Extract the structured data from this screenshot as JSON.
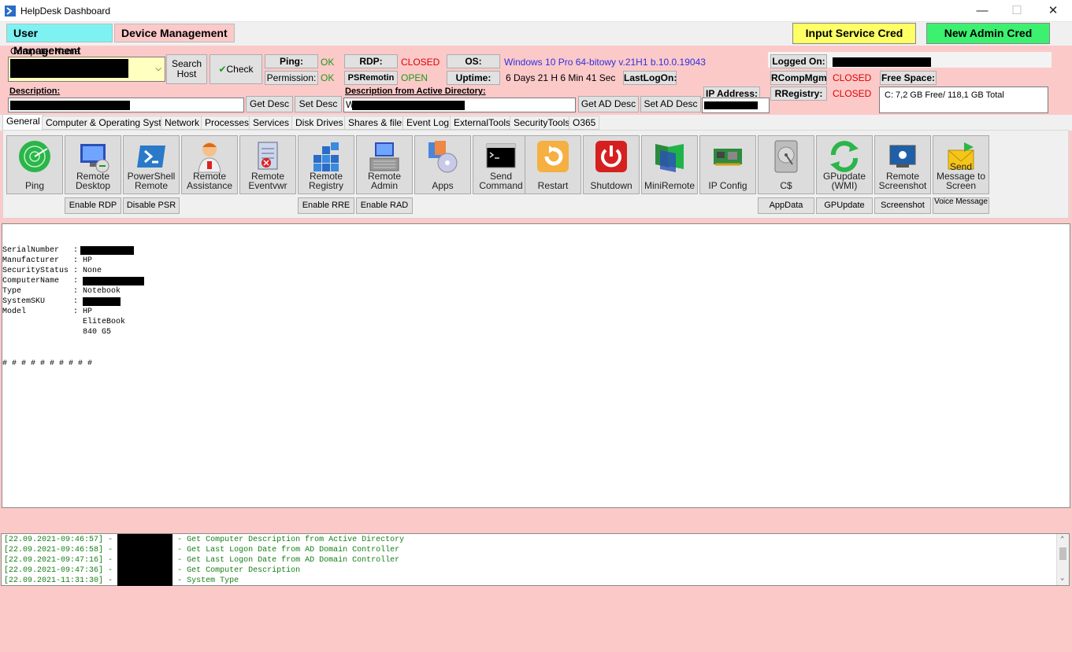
{
  "window": {
    "title": "HelpDesk Dashboard",
    "minimize": "—",
    "maximize": "☐",
    "close": "✕"
  },
  "top_tabs": [
    "User Management",
    "Device Management"
  ],
  "actions": {
    "input_service_cred": "Input Service Cred",
    "new_admin_cred": "New Admin Cred"
  },
  "computer": {
    "label": "Computer Name",
    "search_host": "Search Host",
    "check": "Check"
  },
  "status": {
    "ping_label": "Ping:",
    "ping_value": "OK",
    "permission_label": "Permission:",
    "permission_value": "OK",
    "rdp_label": "RDP:",
    "rdp_value": "CLOSED",
    "psremoting_label": "PSRemotin",
    "psremoting_value": "OPEN",
    "os_label": "OS:",
    "os_value": "Windows 10 Pro 64-bitowy v.21H1 b.10.0.19043",
    "uptime_label": "Uptime:",
    "uptime_value": "6 Days 21 H 6 Min 41 Sec",
    "lastlogon_label": "LastLogOn:",
    "logged_on_label": "Logged On:",
    "rcompmgm_label": "RCompMgm",
    "rcompmgm_value": "CLOSED",
    "rregistry_label": "RRegistry:",
    "rregistry_value": "CLOSED",
    "free_space_label": "Free Space:",
    "free_space_value": "C: 7,2 GB Free/ 118,1 GB Total",
    "ip_label": "IP Address:"
  },
  "description": {
    "label": "Description:",
    "get": "Get Desc",
    "set": "Set Desc",
    "ad_label": "Description from Active Directory:",
    "ad_value": "W",
    "get_ad": "Get AD Desc",
    "set_ad": "Set AD Desc"
  },
  "content_tabs": [
    "General",
    "Computer & Operating System",
    "Network",
    "Processes",
    "Services",
    "Disk Drives",
    "Shares & files",
    "Event Log",
    "ExternalTools",
    "SecurityTools",
    "O365"
  ],
  "tools": [
    {
      "label": "Ping",
      "icon": "radar-icon"
    },
    {
      "label": "Remote Desktop",
      "icon": "remote-desktop-icon"
    },
    {
      "label": "PowerShell Remote",
      "icon": "powershell-icon"
    },
    {
      "label": "Remote Assistance",
      "icon": "assistance-person-icon"
    },
    {
      "label": "Remote Eventvwr",
      "icon": "eventvwr-icon"
    },
    {
      "label": "Remote Registry",
      "icon": "registry-icon"
    },
    {
      "label": "Remote Admin",
      "icon": "admin-computer-icon"
    },
    {
      "label": "Apps",
      "icon": "apps-icon"
    },
    {
      "label": "Send Command",
      "icon": "cmd-icon"
    },
    {
      "label": "Restart",
      "icon": "restart-icon"
    },
    {
      "label": "Shutdown",
      "icon": "power-icon"
    },
    {
      "label": "MiniRemote",
      "icon": "mini-remote-icon"
    },
    {
      "label": "IP Config",
      "icon": "network-card-icon"
    },
    {
      "label": "C$",
      "icon": "hard-drive-icon"
    },
    {
      "label": "GPupdate (WMI)",
      "icon": "gpupdate-icon"
    },
    {
      "label": "Remote Screenshot",
      "icon": "camera-icon"
    },
    {
      "label": "Send Message to Screen",
      "icon": "message-icon"
    }
  ],
  "small_buttons": {
    "enable_rdp": "Enable RDP",
    "disable_psr": "Disable PSR",
    "enable_rre": "Enable RRE",
    "enable_rad": "Enable RAD",
    "appdata": "AppData",
    "gpupdate": "GPUpdate",
    "screenshot": "Screenshot",
    "voice_message": "Voice Message"
  },
  "output": {
    "rows": [
      {
        "key": "SerialNumber",
        "value": ""
      },
      {
        "key": "Manufacturer",
        "value": "HP"
      },
      {
        "key": "SecurityStatus",
        "value": "None"
      },
      {
        "key": "ComputerName",
        "value": ""
      },
      {
        "key": "Type",
        "value": "Notebook"
      },
      {
        "key": "SystemSKU",
        "value": ""
      },
      {
        "key": "Model",
        "value": "HP EliteBook 840 G5"
      }
    ],
    "separator": "# # # # # # # # # #"
  },
  "log": [
    {
      "time": "[22.09.2021-09:46:57]",
      "msg": "- Get Computer Description from Active Directory"
    },
    {
      "time": "[22.09.2021-09:46:58]",
      "msg": "- Get Last Logon Date from AD Domain Controller"
    },
    {
      "time": "[22.09.2021-09:47:16]",
      "msg": "- Get Last Logon Date from AD Domain Controller"
    },
    {
      "time": "[22.09.2021-09:47:36]",
      "msg": "- Get Computer Description"
    },
    {
      "time": "[22.09.2021-11:31:30]",
      "msg": "- System Type"
    }
  ],
  "colors": {
    "accent_pink": "#fcc9c9",
    "tab_user": "#7ef2f2",
    "input_cred": "#ffff66",
    "admin_cred": "#3cf070",
    "status_closed": "#e00000",
    "status_ok": "#1a9b1a",
    "os_text": "#3030e0"
  }
}
